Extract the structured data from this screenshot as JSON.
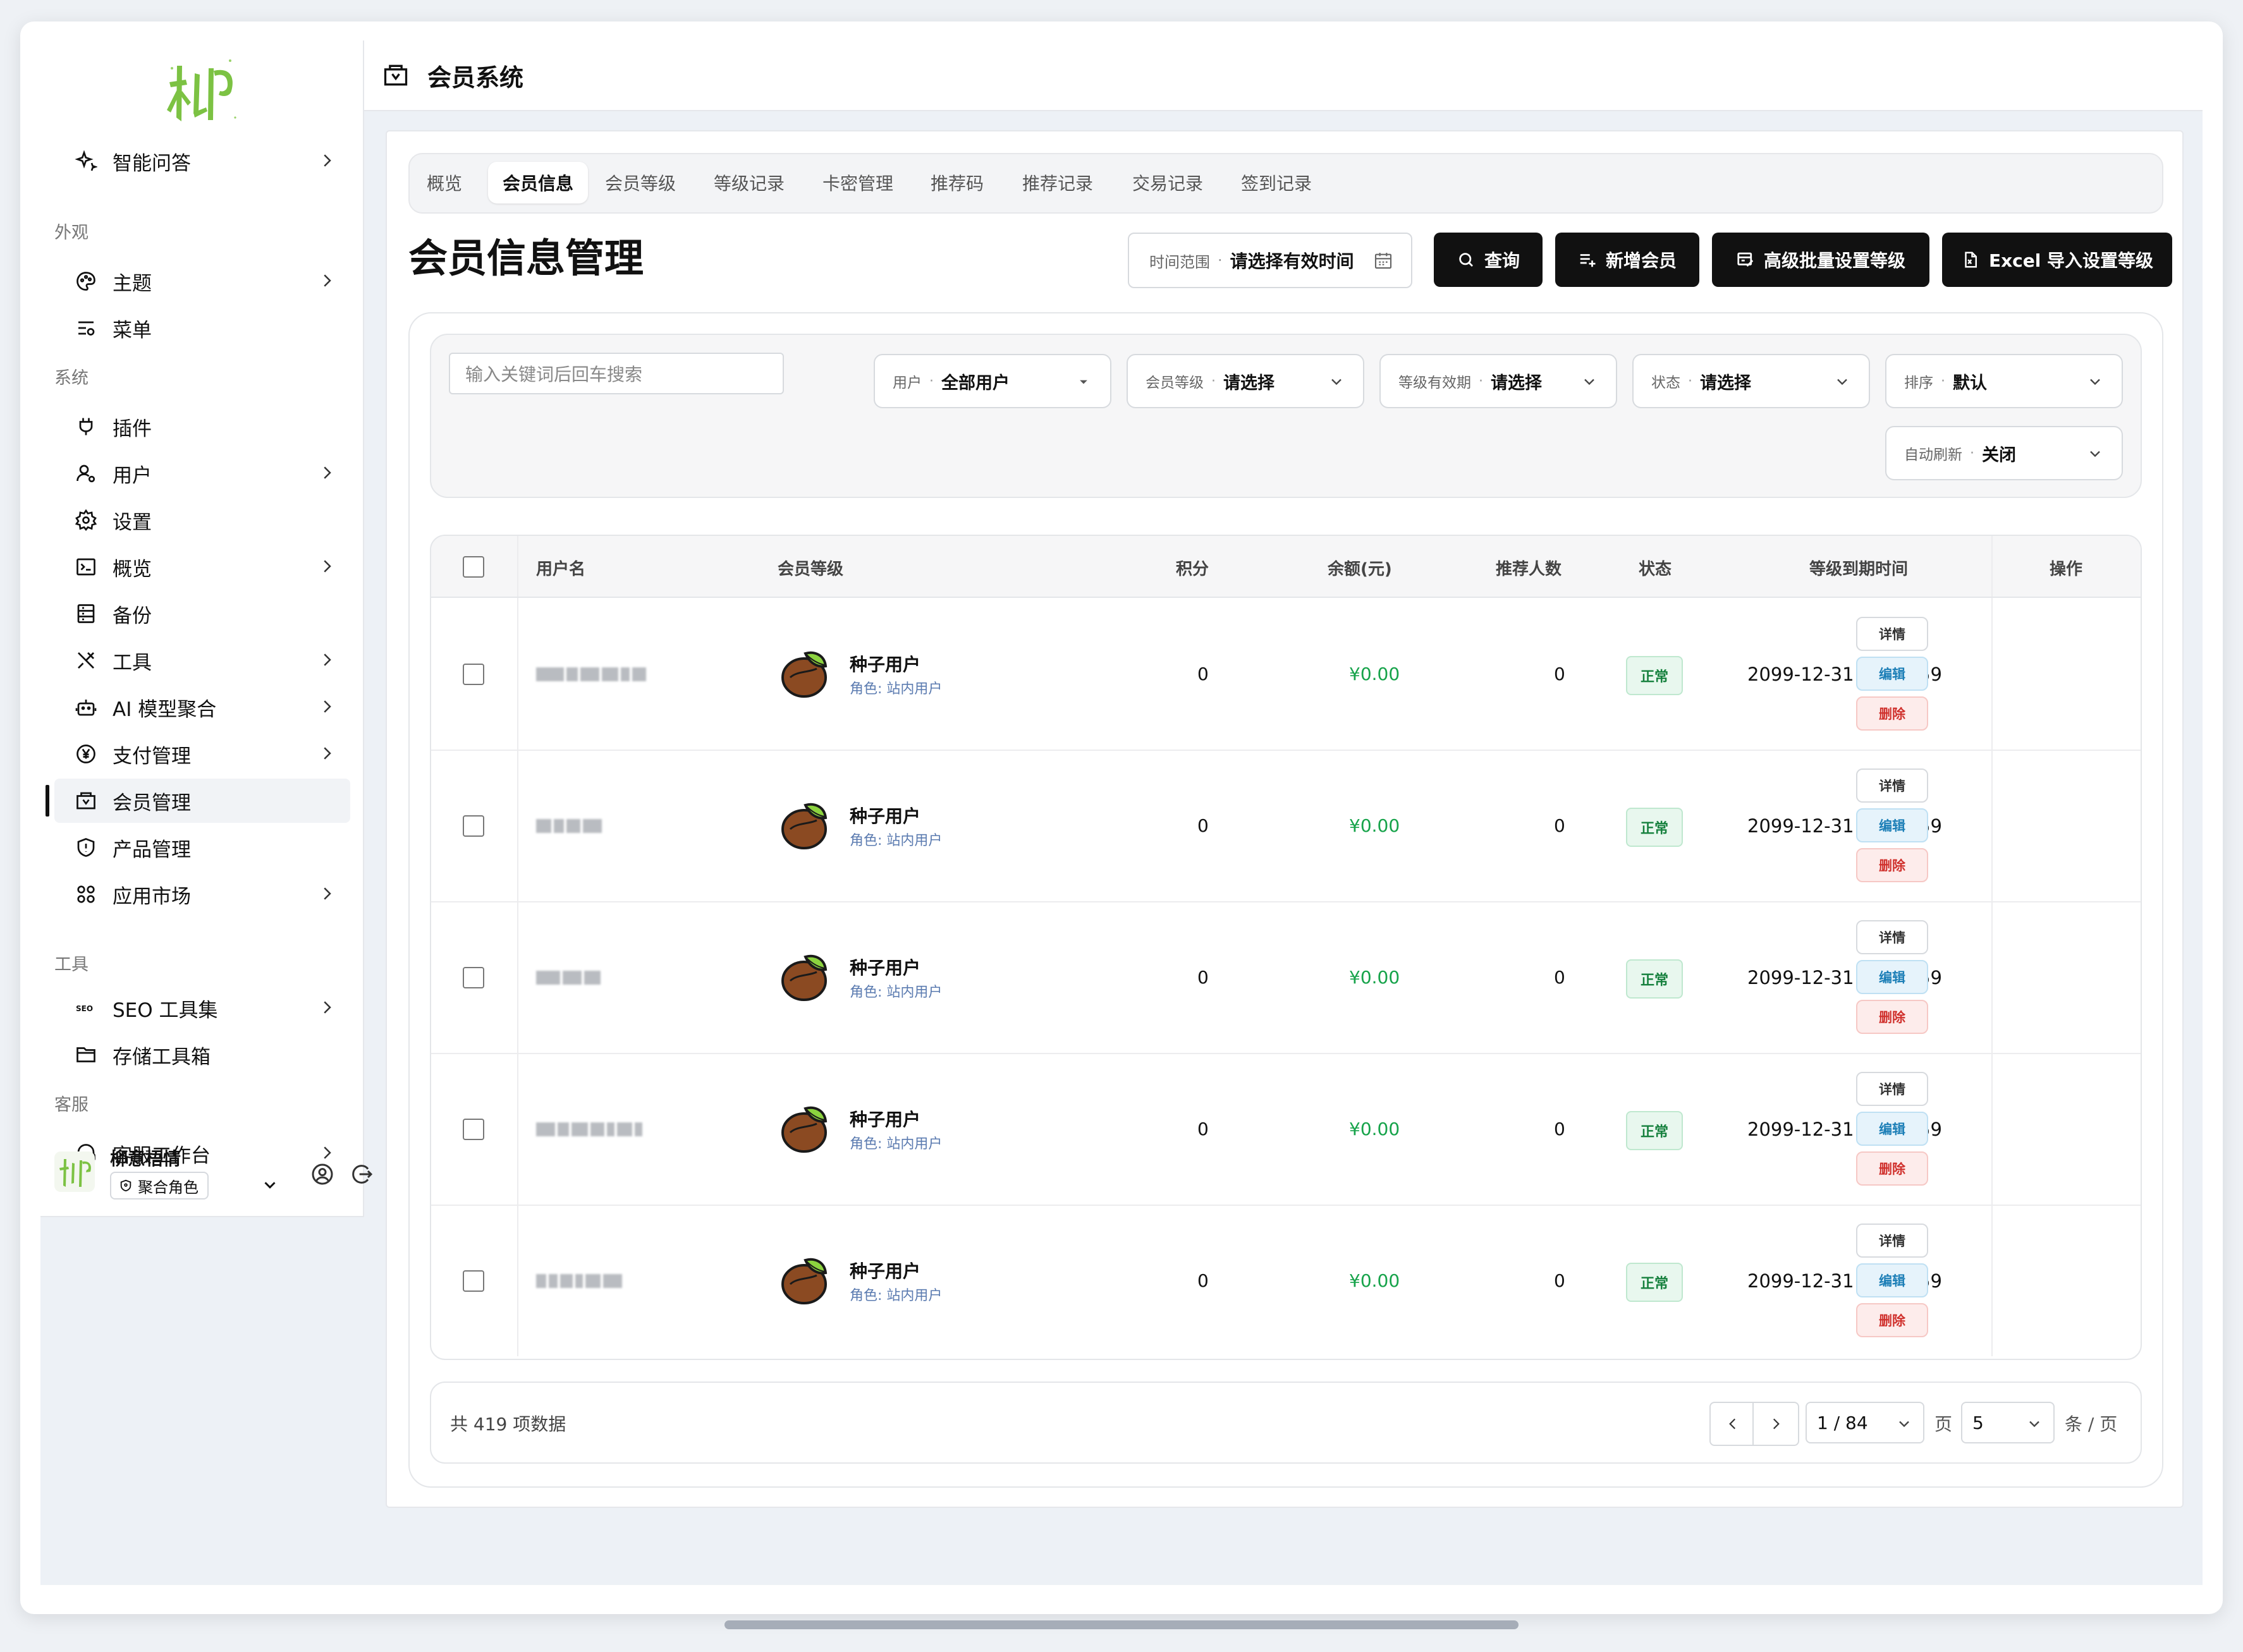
{
  "app": {
    "title": "会员系统"
  },
  "sidebar": {
    "logo_text": "柳",
    "items": [
      {
        "label": "智能问答",
        "icon": "sparkle-icon",
        "chevron": true
      },
      {
        "label": "主题",
        "icon": "palette-icon",
        "chevron": true
      },
      {
        "label": "菜单",
        "icon": "menu-settings-icon",
        "chevron": false
      },
      {
        "label": "插件",
        "icon": "plug-icon",
        "chevron": false
      },
      {
        "label": "用户",
        "icon": "user-icon",
        "chevron": true
      },
      {
        "label": "设置",
        "icon": "gear-icon",
        "chevron": false
      },
      {
        "label": "概览",
        "icon": "terminal-icon",
        "chevron": true
      },
      {
        "label": "备份",
        "icon": "archive-icon",
        "chevron": false
      },
      {
        "label": "工具",
        "icon": "tools-icon",
        "chevron": true
      },
      {
        "label": "AI 模型聚合",
        "icon": "robot-icon",
        "chevron": true
      },
      {
        "label": "支付管理",
        "icon": "yen-icon",
        "chevron": true
      },
      {
        "label": "会员管理",
        "icon": "member-card-icon",
        "chevron": false,
        "active": true
      },
      {
        "label": "产品管理",
        "icon": "shield-icon",
        "chevron": false
      },
      {
        "label": "应用市场",
        "icon": "apps-icon",
        "chevron": true
      },
      {
        "label": "SEO 工具集",
        "icon": "seo-icon",
        "chevron": true
      },
      {
        "label": "存储工具箱",
        "icon": "folder-icon",
        "chevron": false
      },
      {
        "label": "客服工作台",
        "icon": "headset-icon",
        "chevron": true
      }
    ],
    "sections": [
      "外观",
      "系统",
      "工具",
      "客服"
    ],
    "user": {
      "name": "柳意梧情",
      "role": "聚合角色"
    }
  },
  "tabs": [
    "概览",
    "会员信息",
    "会员等级",
    "等级记录",
    "卡密管理",
    "推荐码",
    "推荐记录",
    "交易记录",
    "签到记录"
  ],
  "active_tab": "会员信息",
  "page": {
    "heading": "会员信息管理",
    "date_range": {
      "label": "时间范围",
      "value": "请选择有效时间"
    },
    "buttons": {
      "query": "查询",
      "add_member": "新增会员",
      "batch_level": "高级批量设置等级",
      "excel_import": "Excel 导入设置等级"
    }
  },
  "filters": {
    "search_placeholder": "输入关键词后回车搜索",
    "user": {
      "label": "用户",
      "value": "全部用户"
    },
    "level": {
      "label": "会员等级",
      "value": "请选择"
    },
    "validity": {
      "label": "等级有效期",
      "value": "请选择"
    },
    "status": {
      "label": "状态",
      "value": "请选择"
    },
    "sort": {
      "label": "排序",
      "value": "默认"
    },
    "refresh": {
      "label": "自动刷新",
      "value": "关闭"
    }
  },
  "table": {
    "columns": [
      "用户名",
      "会员等级",
      "积分",
      "余额(元)",
      "推荐人数",
      "状态",
      "等级到期时间",
      "操作"
    ],
    "rows": [
      {
        "level": "种子用户",
        "role": "角色: 站内用户",
        "points": "0",
        "balance": "¥0.00",
        "referrals": "0",
        "status": "正常",
        "expires": "2099-12-31 23:59:59"
      },
      {
        "level": "种子用户",
        "role": "角色: 站内用户",
        "points": "0",
        "balance": "¥0.00",
        "referrals": "0",
        "status": "正常",
        "expires": "2099-12-31 23:59:59"
      },
      {
        "level": "种子用户",
        "role": "角色: 站内用户",
        "points": "0",
        "balance": "¥0.00",
        "referrals": "0",
        "status": "正常",
        "expires": "2099-12-31 23:59:59"
      },
      {
        "level": "种子用户",
        "role": "角色: 站内用户",
        "points": "0",
        "balance": "¥0.00",
        "referrals": "0",
        "status": "正常",
        "expires": "2099-12-31 23:59:59"
      },
      {
        "level": "种子用户",
        "role": "角色: 站内用户",
        "points": "0",
        "balance": "¥0.00",
        "referrals": "0",
        "status": "正常",
        "expires": "2099-12-31 23:59:59"
      }
    ],
    "actions": {
      "detail": "详情",
      "edit": "编辑",
      "delete": "删除"
    }
  },
  "pagination": {
    "total": "共 419 项数据",
    "page": "1 / 84",
    "page_suffix": "页",
    "page_size": "5",
    "size_suffix": "条 / 页"
  },
  "colors": {
    "accent": "#111111",
    "money": "#16a34a",
    "status": "#15803d",
    "edit": "#1d7fb7",
    "delete": "#d0312d"
  }
}
